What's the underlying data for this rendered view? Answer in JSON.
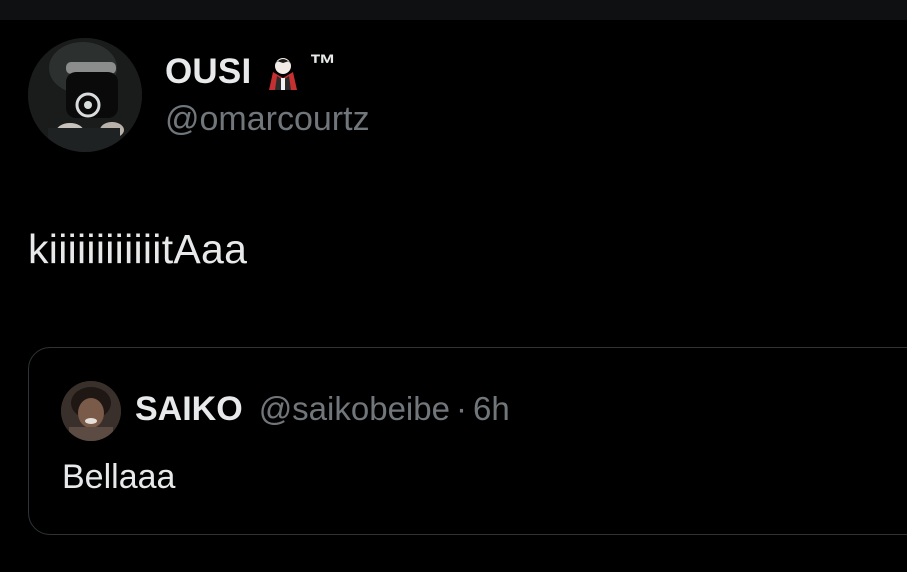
{
  "author": {
    "name": "OUSI",
    "badge_icon": "vampire-emoji",
    "trademark": "™",
    "handle": "@omarcourtz",
    "avatar": "profile-photo"
  },
  "tweet": {
    "text": "kiiiiiiiiiiiitAaa"
  },
  "quoted_tweet": {
    "author_name": "SAIKO",
    "author_handle": "@saikobeibe",
    "separator": "·",
    "time": "6h",
    "text": "Bellaaa",
    "avatar": "profile-photo"
  },
  "colors": {
    "background": "#000000",
    "primary_text": "#e7e9ea",
    "secondary_text": "#71767b",
    "border": "#2f3336"
  }
}
